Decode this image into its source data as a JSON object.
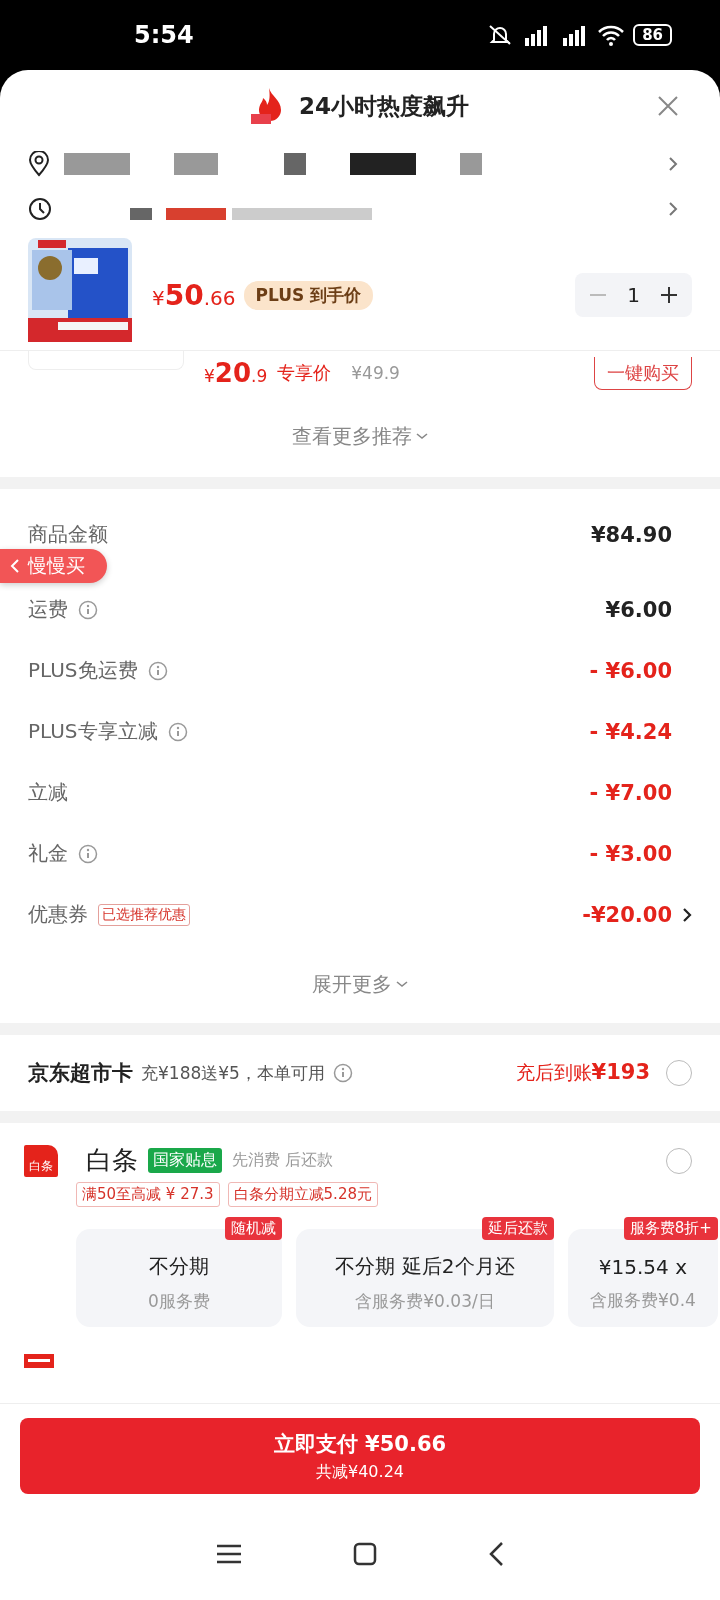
{
  "status_bar": {
    "time": "5:54",
    "battery": "86"
  },
  "header": {
    "title": "24小时热度飙升"
  },
  "product": {
    "currency": "¥",
    "price_int": "50",
    "price_dec": ".66",
    "tag": "PLUS 到手价",
    "quantity": "1"
  },
  "recommendation": {
    "currency": "¥",
    "price_int": "20",
    "price_dec": ".9",
    "label": "专享价",
    "original": "¥49.9",
    "button": "一键购买"
  },
  "more_recommendations": "查看更多推荐",
  "floating_tab": "慢慢买",
  "summary": [
    {
      "label": "商品金额",
      "info": false,
      "kind": "plain",
      "value": "¥84.90"
    },
    {
      "label": "运费",
      "info": true,
      "kind": "plain",
      "value": "¥6.00"
    },
    {
      "label": "PLUS免运费",
      "info": true,
      "kind": "discount",
      "value": "- ¥6.00"
    },
    {
      "label": "PLUS专享立减",
      "info": true,
      "kind": "discount",
      "value": "- ¥4.24"
    },
    {
      "label": "立减",
      "info": false,
      "kind": "discount",
      "value": "- ¥7.00"
    },
    {
      "label": "礼金",
      "info": true,
      "kind": "discount",
      "value": "- ¥3.00"
    },
    {
      "label": "优惠券",
      "info": false,
      "kind": "coupon",
      "tag": "已选推荐优惠",
      "value": "-¥20.00"
    }
  ],
  "expand": "展开更多",
  "supermarket_card": {
    "title": "京东超市卡",
    "desc": "充¥188送¥5，本单可用",
    "reward_label": "充后到账",
    "reward": "¥193",
    "selected": false
  },
  "baitiao": {
    "logo_text": "白条",
    "name": "白条",
    "badge": "国家贴息",
    "note": "先消费 后还款",
    "selected": false,
    "promos": [
      "满50至高减 ¥ 27.3",
      "白条分期立减5.28元"
    ],
    "plans": [
      {
        "tag": "随机减",
        "title": "不分期",
        "sub": "0服务费"
      },
      {
        "tag": "延后还款",
        "title": "不分期  延后2个月还",
        "sub": "含服务费¥0.03/日"
      },
      {
        "tag": "服务费8折+",
        "title": "¥15.54 x",
        "sub": "含服务费¥0.4"
      }
    ]
  },
  "pay_button": {
    "label": "立即支付 ¥50.66",
    "sub": "共减¥40.24"
  }
}
